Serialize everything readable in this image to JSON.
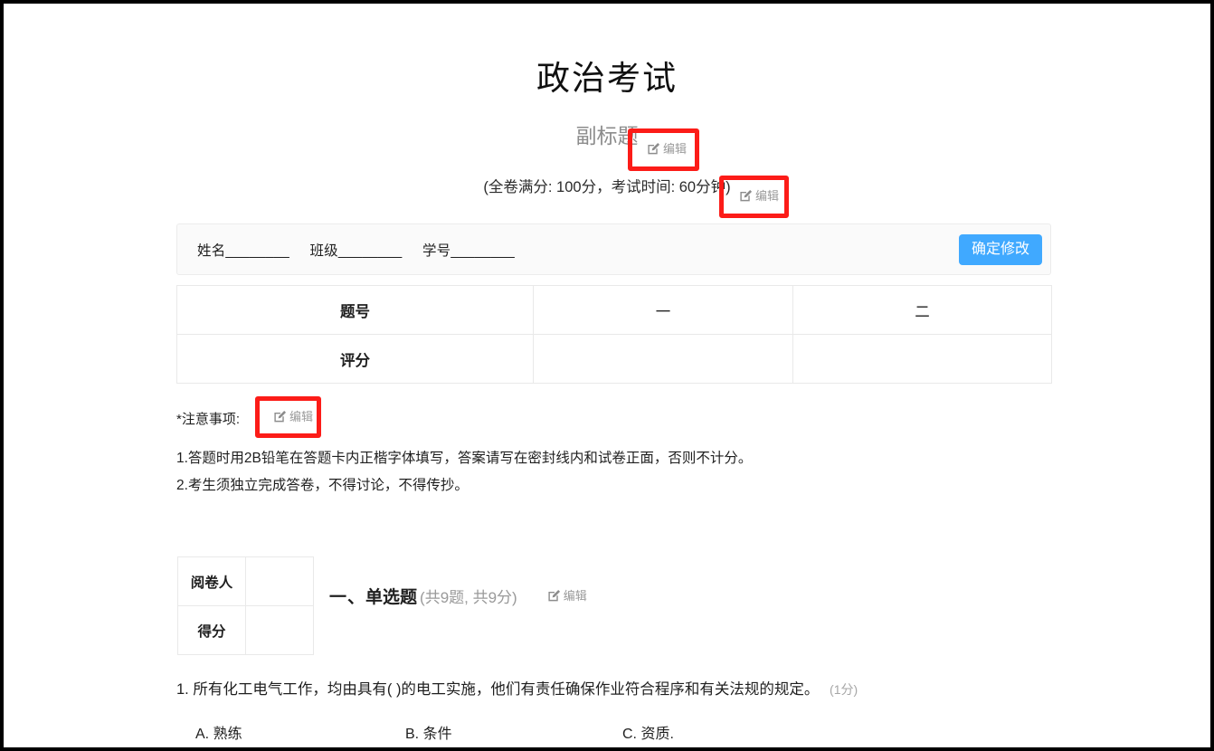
{
  "paper": {
    "title": "政治考试",
    "subtitle": "副标题",
    "exam_meta": "(全卷满分: 100分，考试时间: 60分钟)"
  },
  "edit_button": {
    "label": "编辑",
    "icon": "edit-pencil-square-icon"
  },
  "highlight": {
    "color": "#fc1c18",
    "count": 3
  },
  "student_info": {
    "name_field": "姓名________",
    "class_field": "班级________",
    "id_field": "学号________",
    "confirm_label": "确定修改"
  },
  "score_table": {
    "rows": [
      {
        "label": "题号",
        "cells": [
          "一",
          "二"
        ]
      },
      {
        "label": "评分",
        "cells": [
          "",
          ""
        ]
      }
    ]
  },
  "notes": {
    "heading": "*注意事项:",
    "lines": [
      "1.答题时用2B铅笔在答题卡内正楷字体填写，答案请写在密封线内和试卷正面，否则不计分。",
      "2.考生须独立完成答卷，不得讨论，不得传抄。"
    ]
  },
  "grading_box": {
    "rows": [
      {
        "label": "阅卷人",
        "value": ""
      },
      {
        "label": "得分",
        "value": ""
      }
    ]
  },
  "section": {
    "index": "一、",
    "name": "单选题",
    "count": "(共9题, 共9分)"
  },
  "questions": [
    {
      "number": "1.",
      "stem": "所有化工电气工作，均由具有(  )的电工实施，他们有责任确保作业符合程序和有关法规的规定。",
      "score": "(1分)",
      "options": [
        {
          "key": "A.",
          "text": "熟练"
        },
        {
          "key": "B.",
          "text": "条件"
        },
        {
          "key": "C.",
          "text": "资质."
        }
      ]
    }
  ],
  "colors": {
    "accent_blue": "#40a9ff",
    "highlight_red": "#fc1c18",
    "muted_gray": "#9a9a9a",
    "border_gray": "#e9e9e9",
    "panel_bg": "#fafafa"
  }
}
